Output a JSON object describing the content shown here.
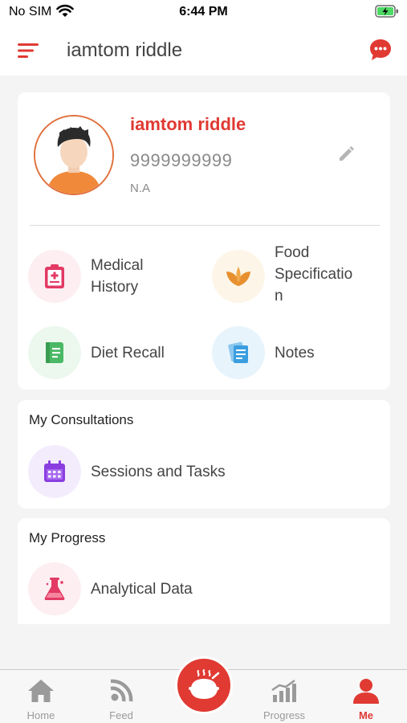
{
  "status_bar": {
    "carrier": "No SIM",
    "time": "6:44 PM"
  },
  "header": {
    "title": "iamtom riddle"
  },
  "profile": {
    "name": "iamtom riddle",
    "phone": "9999999999",
    "extra": "N.A"
  },
  "profile_tiles": [
    {
      "label": "Medical\nHistory",
      "icon": "clipboard-icon",
      "bg": "#fdeef1",
      "color": "#e23a64"
    },
    {
      "label": "Food\nSpecificatio\nn",
      "icon": "leaf-icon",
      "bg": "#fdf6e8",
      "color": "#e8902f"
    },
    {
      "label": "Diet Recall",
      "icon": "notebook-icon",
      "bg": "#ecf8ee",
      "color": "#4ab865"
    },
    {
      "label": "Notes",
      "icon": "notes-icon",
      "bg": "#e8f4fc",
      "color": "#3b9ee0"
    }
  ],
  "consultations": {
    "title": "My Consultations",
    "items": [
      {
        "label": "Sessions and Tasks",
        "icon": "calendar-icon",
        "bg": "#f3ecfd",
        "color": "#8a3ee0"
      }
    ]
  },
  "progress": {
    "title": "My Progress",
    "items": [
      {
        "label": "Analytical Data",
        "icon": "flask-icon",
        "bg": "#fdeef1",
        "color": "#e23a64"
      }
    ]
  },
  "tabs": [
    {
      "label": "Home",
      "icon": "home-icon",
      "active": false
    },
    {
      "label": "Feed",
      "icon": "feed-icon",
      "active": false
    },
    {
      "label": "Progress",
      "icon": "chart-icon",
      "active": false
    },
    {
      "label": "Me",
      "icon": "user-icon",
      "active": true
    }
  ],
  "colors": {
    "accent": "#e03a33",
    "inactive_tab": "#9a9a9a"
  }
}
